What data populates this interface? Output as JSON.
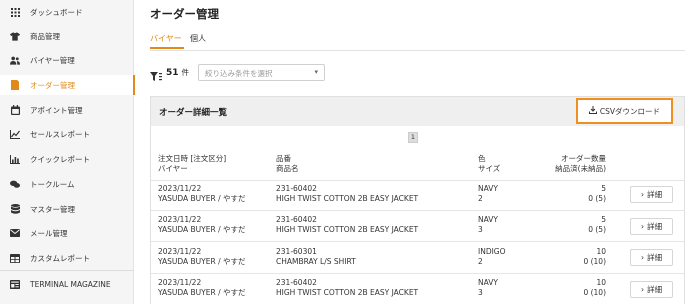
{
  "sidebar": {
    "items": [
      {
        "label": "ダッシュボード",
        "icon": "dashboard-icon"
      },
      {
        "label": "商品管理",
        "icon": "shirt-icon"
      },
      {
        "label": "バイヤー管理",
        "icon": "users-icon"
      },
      {
        "label": "オーダー管理",
        "icon": "order-document-icon"
      },
      {
        "label": "アポイント管理",
        "icon": "calendar-icon"
      },
      {
        "label": "セールスレポート",
        "icon": "line-chart-icon"
      },
      {
        "label": "クイックレポート",
        "icon": "bar-chart-icon"
      },
      {
        "label": "トークルーム",
        "icon": "chat-icon"
      },
      {
        "label": "マスター管理",
        "icon": "database-icon"
      },
      {
        "label": "メール管理",
        "icon": "mail-icon"
      },
      {
        "label": "カスタムレポート",
        "icon": "table-icon"
      },
      {
        "label": "TERMINAL MAGAZINE",
        "icon": "magazine-icon"
      }
    ],
    "active_index": 3,
    "accent_color": "#e08a1a"
  },
  "header": {
    "title": "オーダー管理"
  },
  "tabs": [
    {
      "label": "バイヤー"
    },
    {
      "label": "個人"
    }
  ],
  "filter": {
    "count": "51",
    "unit": "件",
    "placeholder": "絞り込み条件を選択"
  },
  "panel": {
    "title": "オーダー詳細一覧",
    "csv_button": "CSVダウンロード",
    "page": "1",
    "columns": {
      "col1_line1": "注文日時 [注文区分]",
      "col1_line2": "バイヤー",
      "col2_line1": "品番",
      "col2_line2": "商品名",
      "col3_line1": "色",
      "col3_line2": "サイズ",
      "col4_line1": "オーダー数量",
      "col4_line2": "納品済(未納品)"
    },
    "rows": [
      {
        "date": "2023/11/22",
        "buyer": "YASUDA BUYER / やすだ",
        "code": "231-60402",
        "name": "HIGH TWIST COTTON 2B EASY JACKET",
        "color": "NAVY",
        "size": "2",
        "qty": "5",
        "delivered": "0 (5)",
        "button": "詳細"
      },
      {
        "date": "2023/11/22",
        "buyer": "YASUDA BUYER / やすだ",
        "code": "231-60402",
        "name": "HIGH TWIST COTTON 2B EASY JACKET",
        "color": "NAVY",
        "size": "3",
        "qty": "5",
        "delivered": "0 (5)",
        "button": "詳細"
      },
      {
        "date": "2023/11/22",
        "buyer": "YASUDA BUYER / やすだ",
        "code": "231-60301",
        "name": "CHAMBRAY L/S SHIRT",
        "color": "INDIGO",
        "size": "2",
        "qty": "10",
        "delivered": "0 (10)",
        "button": "詳細"
      },
      {
        "date": "2023/11/22",
        "buyer": "YASUDA BUYER / やすだ",
        "code": "231-60402",
        "name": "HIGH TWIST COTTON 2B EASY JACKET",
        "color": "NAVY",
        "size": "3",
        "qty": "10",
        "delivered": "0 (10)",
        "button": "詳細"
      }
    ]
  }
}
